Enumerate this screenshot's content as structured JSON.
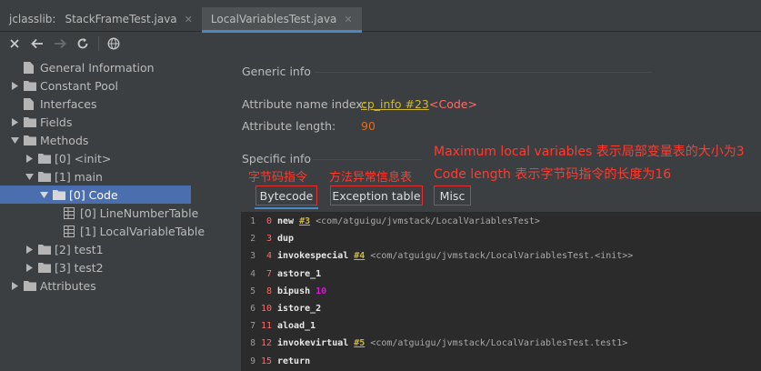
{
  "tabbar": {
    "prefix": "jclasslib:",
    "tabs": [
      {
        "label": "StackFrameTest.java",
        "close": "✕"
      },
      {
        "label": "LocalVariablesTest.java",
        "close": "✕"
      }
    ]
  },
  "toolbar": {
    "icons": [
      "close-icon",
      "back-arrow-icon",
      "forward-arrow-icon",
      "refresh-icon",
      "browser-globe-icon"
    ]
  },
  "tree": {
    "general_information": "General Information",
    "constant_pool": "Constant Pool",
    "interfaces": "Interfaces",
    "fields": "Fields",
    "methods": "Methods",
    "method_init": "[0] <init>",
    "method_main": "[1] main",
    "main_code": "[0] Code",
    "line_number_table": "[0] LineNumberTable",
    "local_variable_table": "[1] LocalVariableTable",
    "method_test1": "[2] test1",
    "method_test2": "[3] test2",
    "attributes": "Attributes"
  },
  "generic": {
    "header": "Generic info",
    "name_index_label": "Attribute name index:",
    "name_index_link": "cp_info #23",
    "name_index_value": "<Code>",
    "length_label": "Attribute length:",
    "length_value": "90"
  },
  "specific": {
    "header": "Specific info",
    "tabs": [
      "Bytecode",
      "Exception table",
      "Misc"
    ]
  },
  "annotations": {
    "bytecode_note": "字节码指令",
    "exception_note": "方法异常信息表",
    "misc_note_1": "Maximum local variables 表示局部变量表的大小为3",
    "misc_note_2": "Code length 表示字节码指令的长度为16"
  },
  "bytecode": [
    {
      "line": "1",
      "offset": "0",
      "op": "new",
      "ref": "#3",
      "comment": "<com/atguigu/jvmstack/LocalVariablesTest>",
      "imm": ""
    },
    {
      "line": "2",
      "offset": "3",
      "op": "dup",
      "ref": "",
      "comment": "",
      "imm": ""
    },
    {
      "line": "3",
      "offset": "4",
      "op": "invokespecial",
      "ref": "#4",
      "comment": "<com/atguigu/jvmstack/LocalVariablesTest.<init>>",
      "imm": ""
    },
    {
      "line": "4",
      "offset": "7",
      "op": "astore_1",
      "ref": "",
      "comment": "",
      "imm": ""
    },
    {
      "line": "5",
      "offset": "8",
      "op": "bipush",
      "ref": "",
      "comment": "",
      "imm": "10"
    },
    {
      "line": "6",
      "offset": "10",
      "op": "istore_2",
      "ref": "",
      "comment": "",
      "imm": ""
    },
    {
      "line": "7",
      "offset": "11",
      "op": "aload_1",
      "ref": "",
      "comment": "",
      "imm": ""
    },
    {
      "line": "8",
      "offset": "12",
      "op": "invokevirtual",
      "ref": "#5",
      "comment": "<com/atguigu/jvmstack/LocalVariablesTest.test1>",
      "imm": ""
    },
    {
      "line": "9",
      "offset": "15",
      "op": "return",
      "ref": "",
      "comment": "",
      "imm": ""
    }
  ],
  "colors": {
    "background": "#3c3f41",
    "code_background": "#2b2b2b",
    "selection": "#4b6eaf",
    "annotation_red": "#ff3b30",
    "link_yellow": "#cfb830",
    "value_orange": "#e46a1a"
  }
}
